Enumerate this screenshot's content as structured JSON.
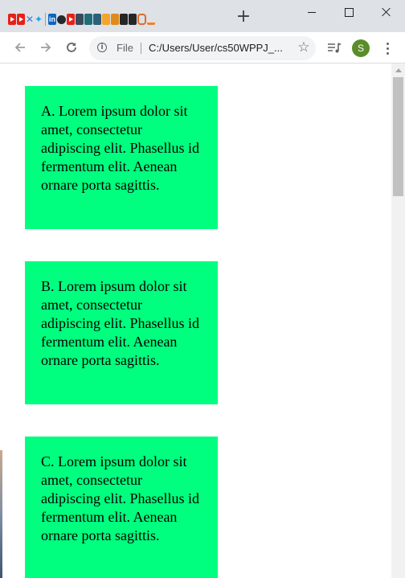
{
  "window": {
    "new_tab_symbol": "+",
    "controls": [
      "minimize",
      "maximize",
      "close"
    ]
  },
  "tabs": {
    "favicons": [
      "youtube-icon",
      "youtube-icon",
      "cross-icon",
      "twitter-icon",
      "linkedin-icon",
      "github-icon",
      "youtube-icon",
      "site-icon",
      "site-icon",
      "site-icon",
      "site-icon",
      "site-icon",
      "site-icon",
      "site-icon",
      "site-icon",
      "stackoverflow-icon"
    ]
  },
  "toolbar": {
    "scheme_label": "File",
    "url": "C:/Users/User/cs50WPPJ_...",
    "profile_initial": "S",
    "profile_color": "#5b8c2a"
  },
  "page": {
    "box_color": "#00ff7f",
    "boxes": [
      {
        "text": "A. Lorem ipsum dolor sit amet, consectetur adipiscing elit. Phasellus id fermentum elit. Aenean ornare porta sagittis."
      },
      {
        "text": "B. Lorem ipsum dolor sit amet, consectetur adipiscing elit. Phasellus id fermentum elit. Aenean ornare porta sagittis."
      },
      {
        "text": "C. Lorem ipsum dolor sit amet, consectetur adipiscing elit. Phasellus id fermentum elit. Aenean ornare porta sagittis."
      }
    ]
  }
}
